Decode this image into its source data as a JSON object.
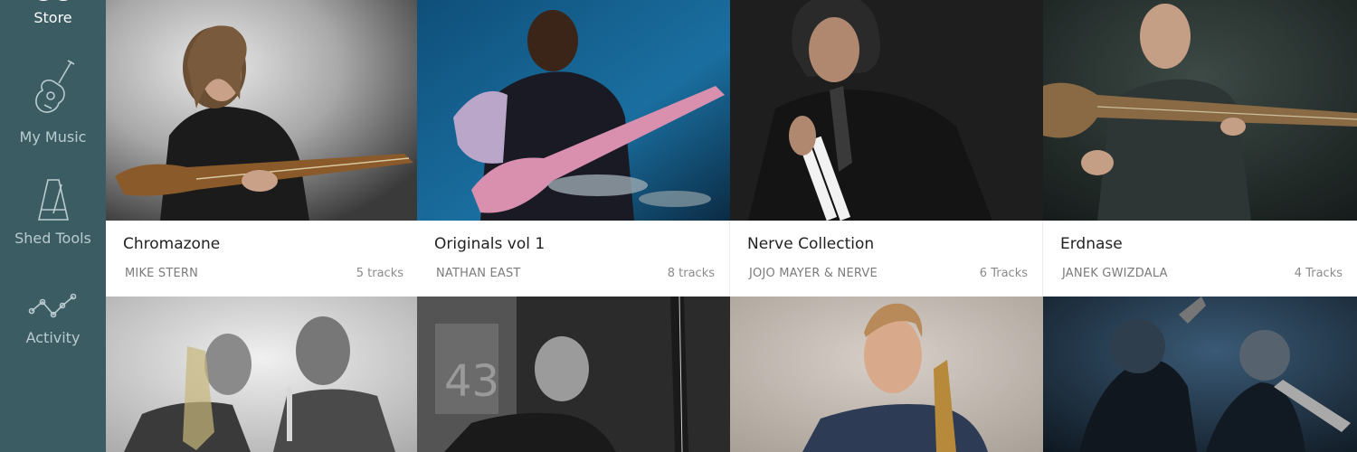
{
  "sidebar": {
    "items": [
      {
        "label": "Store",
        "icon": "store-icon",
        "active": true
      },
      {
        "label": "My Music",
        "icon": "guitar-icon",
        "active": false
      },
      {
        "label": "Shed Tools",
        "icon": "metronome-icon",
        "active": false
      },
      {
        "label": "Activity",
        "icon": "activity-graph-icon",
        "active": false
      }
    ]
  },
  "albums": [
    {
      "title": "Chromazone",
      "artist": "MIKE STERN",
      "tracks": "5 tracks"
    },
    {
      "title": "Originals vol 1",
      "artist": "NATHAN EAST",
      "tracks": "8 tracks"
    },
    {
      "title": "Nerve Collection",
      "artist": "JOJO MAYER & NERVE",
      "tracks": "6 Tracks"
    },
    {
      "title": "Erdnase",
      "artist": "JANEK GWIZDALA",
      "tracks": "4 Tracks"
    }
  ],
  "photo_texts": {
    "locker_number": "43"
  },
  "colors": {
    "sidebar_bg": "#3c5c64",
    "nav_inactive": "#b9cbcf",
    "nav_active": "#ffffff"
  }
}
